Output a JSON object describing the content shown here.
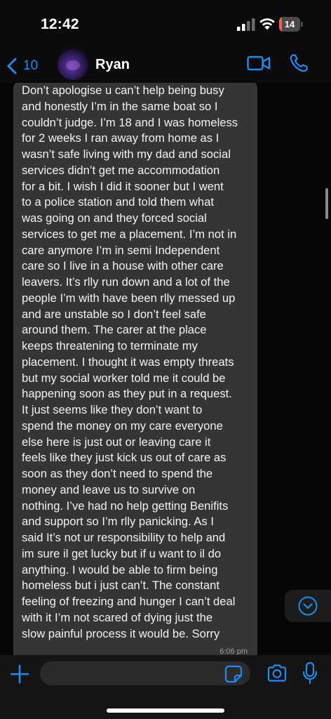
{
  "status_bar": {
    "time": "12:42",
    "battery_level": "14",
    "battery_fraction": 0.14,
    "battery_color": "#ff5a4f"
  },
  "header": {
    "back_count": "10",
    "contact_name": "Ryan",
    "accent_color": "#1e8cf0",
    "icons": [
      "chevron-left-icon",
      "video-camera-icon",
      "phone-icon"
    ]
  },
  "message": {
    "text": "Don’t apologise u can’t help being busy\nand honestly I’m in the same boat so I\ncouldn’t judge. I’m 18 and I was homeless\nfor 2 weeks I ran away from home as I\nwasn’t safe living with my dad and social\nservices didn’t get me accommodation\nfor a bit. I wish I did it sooner but I went\nto a police station and told them what\nwas going on and they forced social\nservices to get me a placement. I’m not in\ncare anymore I’m in semi Independent\ncare so I live in a house with other care\nleavers. It’s rlly run down and a lot of the\npeople I’m with have been rlly messed up\nand are unstable so I don’t feel safe\naround them. The carer at the place\nkeeps threatening to terminate my\nplacement. I thought it was empty threats\nbut my social worker told me it could be\nhappening soon as they put in a request.\nIt just seems like they don’t want to\nspend the money on my care everyone\nelse here is just out or leaving care it\nfeels like they just kick us out of care as\nsoon as they don’t need to spend the\nmoney and leave us to survive on\nnothing. I’ve had no help getting Benifits\nand support so I’m rlly panicking. As I\nsaid It’s not ur responsibility to help and\nim sure il get lucky but if u want to il do\nanything. I would be able to firm being\nhomeless but i just can’t. The constant\nfeeling of freezing and hunger I can’t deal\nwith it I’m not scared of dying just the\nslow painful process it would be. Sorry",
    "time": "6:06 pm",
    "bubble_color": "#353535"
  },
  "input_bar": {
    "placeholder": "",
    "icons": [
      "plus-icon",
      "sticker-icon",
      "camera-icon",
      "microphone-icon"
    ]
  },
  "scroll_button": {
    "icon": "chevron-down-circle-icon"
  }
}
